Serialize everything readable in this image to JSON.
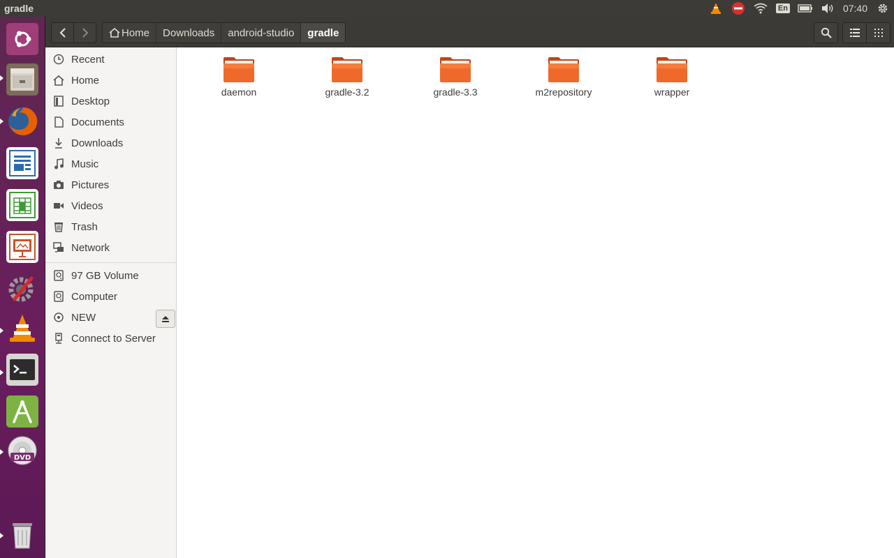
{
  "window": {
    "title": "gradle"
  },
  "tray": {
    "keyboard": "En",
    "clock": "07:40"
  },
  "launcher": {
    "items": [
      {
        "icon": "ubuntu-dash-icon",
        "color": "#e95420"
      },
      {
        "icon": "files-icon",
        "color": "#9b8a78"
      },
      {
        "icon": "firefox-icon",
        "color": "#e66000"
      },
      {
        "icon": "libreoffice-writer-icon",
        "color": "#2a6ab2"
      },
      {
        "icon": "libreoffice-calc-icon",
        "color": "#3f9b33"
      },
      {
        "icon": "libreoffice-impress-icon",
        "color": "#c7552a"
      },
      {
        "icon": "system-settings-icon",
        "color": "#9a9a9a"
      },
      {
        "icon": "vlc-icon",
        "color": "#f28a00"
      },
      {
        "icon": "terminal-icon",
        "color": "#2c2c2c"
      },
      {
        "icon": "android-studio-icon",
        "color": "#7cb342"
      },
      {
        "icon": "dvd-icon",
        "color": "#d7d7d7"
      },
      {
        "icon": "trash-icon",
        "color": "#bdbdbd"
      }
    ]
  },
  "toolbar": {
    "back_icon": "go-back-icon",
    "forward_icon": "go-forward-icon",
    "breadcrumbs": [
      {
        "label": "Home",
        "icon": "home-icon"
      },
      {
        "label": "Downloads"
      },
      {
        "label": "android-studio"
      },
      {
        "label": "gradle",
        "active": true
      }
    ]
  },
  "sidebar": {
    "places": [
      {
        "label": "Recent",
        "icon": "clock-icon"
      },
      {
        "label": "Home",
        "icon": "home-icon"
      },
      {
        "label": "Desktop",
        "icon": "desktop-icon"
      },
      {
        "label": "Documents",
        "icon": "document-icon"
      },
      {
        "label": "Downloads",
        "icon": "download-icon"
      },
      {
        "label": "Music",
        "icon": "music-icon"
      },
      {
        "label": "Pictures",
        "icon": "camera-icon"
      },
      {
        "label": "Videos",
        "icon": "video-icon"
      },
      {
        "label": "Trash",
        "icon": "trash-icon"
      },
      {
        "label": "Network",
        "icon": "network-icon"
      }
    ],
    "devices": [
      {
        "label": "97 GB Volume",
        "icon": "drive-icon"
      },
      {
        "label": "Computer",
        "icon": "drive-icon"
      },
      {
        "label": "NEW",
        "icon": "disc-icon"
      },
      {
        "label": "Connect to Server",
        "icon": "server-icon"
      }
    ]
  },
  "files": [
    {
      "name": "daemon"
    },
    {
      "name": "gradle-3.2"
    },
    {
      "name": "gradle-3.3"
    },
    {
      "name": "m2repository"
    },
    {
      "name": "wrapper"
    }
  ],
  "colors": {
    "folder": "#e95420",
    "panel": "#3c3b37",
    "launcher": "#5e2750"
  }
}
